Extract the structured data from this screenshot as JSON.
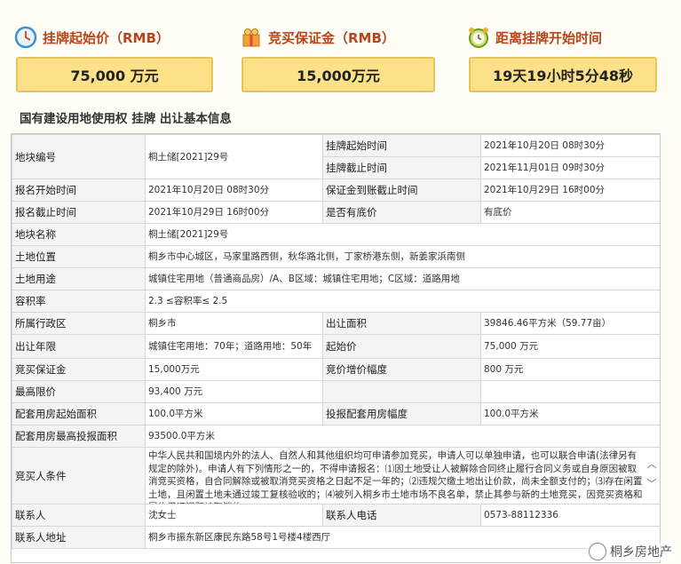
{
  "panels": [
    {
      "title": "挂牌起始价（RMB）",
      "value": "75,000 万元",
      "icon": "clock-icon"
    },
    {
      "title": "竞买保证金（RMB）",
      "value": "15,000万元",
      "icon": "gift-icon"
    },
    {
      "title": "距离挂牌开始时间",
      "value": "19天19小时5分48秒",
      "icon": "alarm-clock-icon"
    }
  ],
  "section_title": "国有建设用地使用权 挂牌 出让基本信息",
  "info": {
    "r1": {
      "l1": "地块编号",
      "v1": "桐土储[2021]29号",
      "l2": "挂牌起始时间",
      "v2": "2021年10月20日 08时30分",
      "l3": "挂牌截止时间",
      "v3": "2021年11月01日 09时30分"
    },
    "r2": {
      "l1": "报名开始时间",
      "v1": "2021年10月20日 08时30分",
      "l2": "保证金到账截止时间",
      "v2": "2021年10月29日 16时00分"
    },
    "r3": {
      "l1": "报名截止时间",
      "v1": "2021年10月29日 16时00分",
      "l2": "是否有底价",
      "v2": "有底价"
    },
    "r4": {
      "l1": "地块名称",
      "v1": "桐土储[2021]29号"
    },
    "r5": {
      "l1": "土地位置",
      "v1": "桐乡市中心城区，马家里路西侧，秋华路北侧，丁家桥港东侧，新姜家浜南侧"
    },
    "r6": {
      "l1": "土地用途",
      "v1": "城镇住宅用地（普通商品房）/A、B区域：城镇住宅用地；C区域：道路用地"
    },
    "r7": {
      "l1": "容积率",
      "v1": "2.3 ≤容积率≤ 2.5"
    },
    "r8": {
      "l1": "所属行政区",
      "v1": "桐乡市",
      "l2": "出让面积",
      "v2": "39846.46平方米（59.77亩）"
    },
    "r9": {
      "l1": "出让年限",
      "v1": "城镇住宅用地：70年；道路用地：50年",
      "l2": "起始价",
      "v2": "75,000 万元"
    },
    "r10": {
      "l1": "竞买保证金",
      "v1": "15,000万元",
      "l2": "竞价增价幅度",
      "v2": "800 万元"
    },
    "r11": {
      "l1": "最高限价",
      "v1": "93,400 万元"
    },
    "r12": {
      "l1": "配套用房起始面积",
      "v1": "100.0平方米",
      "l2": "投报配套用房幅度",
      "v2": "100.0平方米"
    },
    "r13": {
      "l1": "配套用房最高投报面积",
      "v1": "93500.0平方米"
    },
    "r14": {
      "l1": "竞买人条件",
      "v1": "中华人民共和国境内外的法人、自然人和其他组织均可申请参加竞买，申请人可以单独申请，也可以联合申请(法律另有规定的除外)。申请人有下列情形之一的，不得申请报名：⑴因土地受让人被解除合同终止履行合同义务或自身原因被取消竞买资格，自合同解除或被取消竞买资格之日起不足一年的；⑵违规欠缴土地出让价款，尚未全额支付的；⑶存在闲置土地，且闲置土地未通过竣工复核验收的；⑷被列入桐乡市土地市场不良名单，禁止其参与新的土地竞买，因竞买资格和履约保证问题被取消的。"
    },
    "r15": {
      "l1": "联系人",
      "v1": "沈女士",
      "l2": "联系人电话",
      "v2": "0573-88112336"
    },
    "r16": {
      "l1": "联系人地址",
      "v1": "桐乡市振东新区康民东路58号1号楼4楼西厅"
    }
  },
  "watermark": "桐乡房地产",
  "colors": {
    "title_orange": "#b9451c",
    "box_fill": "#fde188",
    "box_border": "#e8c45b",
    "label_bg": "#f4f4f4"
  }
}
